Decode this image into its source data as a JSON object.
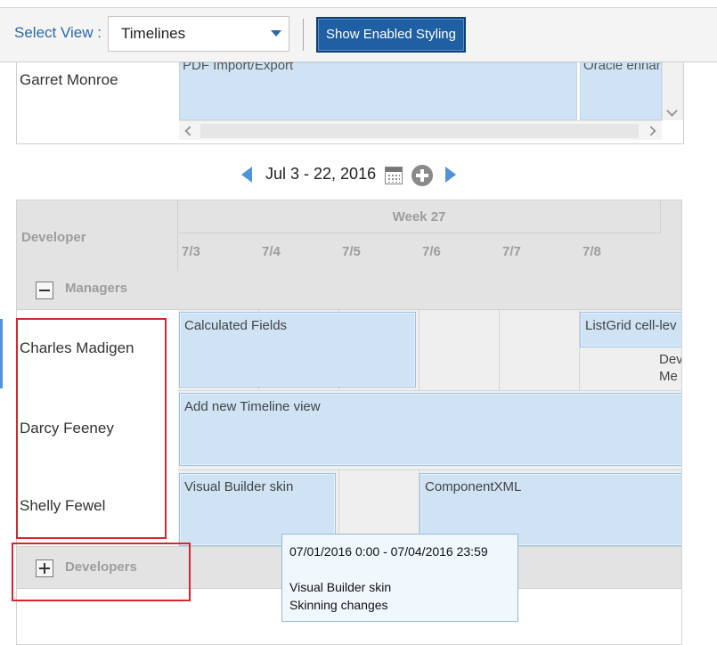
{
  "toolbar": {
    "select_label": "Select View :",
    "select_value": "Timelines",
    "styling_button": "Show Enabled Styling"
  },
  "top_pane": {
    "lane_name": "Garret Monroe",
    "events": [
      "PDF Import/Export",
      "Oracle enhan"
    ]
  },
  "navigator": {
    "range": "Jul 3 - 22, 2016"
  },
  "timeline": {
    "header_dev": "Developer",
    "week_label": "Week 27",
    "days": [
      "7/3",
      "7/4",
      "7/5",
      "7/6",
      "7/7",
      "7/8"
    ],
    "groups": {
      "managers": "Managers",
      "developers": "Developers"
    },
    "lanes": [
      "Charles Madigen",
      "Darcy Feeney",
      "Shelly Fewel"
    ],
    "events": {
      "calculated_fields": "Calculated Fields",
      "listgrid": "ListGrid cell-lev",
      "dev_me_line1": "Dev",
      "dev_me_line2": "Me",
      "timeline_view": "Add new Timeline view",
      "visual_builder": "Visual Builder skin",
      "component_xml": "ComponentXML"
    }
  },
  "tooltip": {
    "range": "07/01/2016 0:00 - 07/04/2016 23:59",
    "title": "Visual Builder skin",
    "description": "Skinning changes"
  },
  "colors": {
    "accent": "#2a67ad",
    "button": "#1f5fa3",
    "event_fill": "#cfe3f5",
    "highlight": "#d9242b"
  }
}
